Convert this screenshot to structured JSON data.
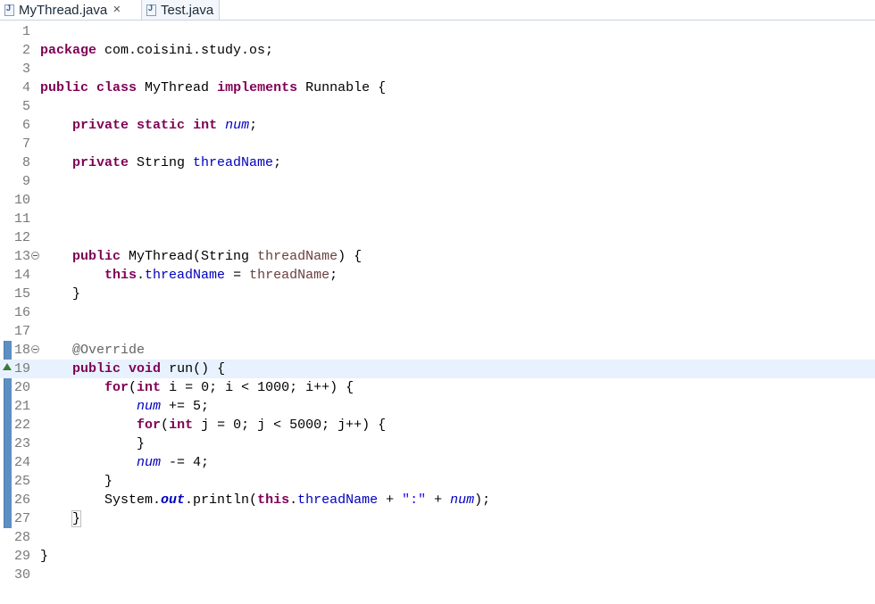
{
  "tabs": [
    {
      "label": "MyThread.java",
      "active": true,
      "close": "✕"
    },
    {
      "label": "Test.java",
      "active": false
    }
  ],
  "editor": {
    "current_line": 19,
    "lines": [
      {
        "n": "1",
        "tokens": []
      },
      {
        "n": "2",
        "tokens": [
          [
            "kw",
            "package"
          ],
          [
            "p",
            " com.coisini.study.os;"
          ]
        ]
      },
      {
        "n": "3",
        "tokens": []
      },
      {
        "n": "4",
        "tokens": [
          [
            "kw",
            "public"
          ],
          [
            "p",
            " "
          ],
          [
            "kw",
            "class"
          ],
          [
            "p",
            " MyThread "
          ],
          [
            "kw",
            "implements"
          ],
          [
            "p",
            " Runnable {"
          ]
        ]
      },
      {
        "n": "5",
        "tokens": []
      },
      {
        "n": "6",
        "tokens": [
          [
            "p",
            "    "
          ],
          [
            "kw",
            "private"
          ],
          [
            "p",
            " "
          ],
          [
            "kw",
            "static"
          ],
          [
            "p",
            " "
          ],
          [
            "kw",
            "int"
          ],
          [
            "p",
            " "
          ],
          [
            "sfld",
            "num"
          ],
          [
            "p",
            ";"
          ]
        ]
      },
      {
        "n": "7",
        "tokens": []
      },
      {
        "n": "8",
        "tokens": [
          [
            "p",
            "    "
          ],
          [
            "kw",
            "private"
          ],
          [
            "p",
            " String "
          ],
          [
            "fld",
            "threadName"
          ],
          [
            "p",
            ";"
          ]
        ]
      },
      {
        "n": "9",
        "tokens": []
      },
      {
        "n": "10",
        "tokens": []
      },
      {
        "n": "11",
        "tokens": []
      },
      {
        "n": "12",
        "tokens": []
      },
      {
        "n": "13",
        "fold": true,
        "tokens": [
          [
            "p",
            "    "
          ],
          [
            "kw",
            "public"
          ],
          [
            "p",
            " MyThread(String "
          ],
          [
            "local",
            "threadName"
          ],
          [
            "p",
            ") {"
          ]
        ]
      },
      {
        "n": "14",
        "tokens": [
          [
            "p",
            "        "
          ],
          [
            "kw",
            "this"
          ],
          [
            "p",
            "."
          ],
          [
            "fld",
            "threadName"
          ],
          [
            "p",
            " = "
          ],
          [
            "local",
            "threadName"
          ],
          [
            "p",
            ";"
          ]
        ]
      },
      {
        "n": "15",
        "tokens": [
          [
            "p",
            "    }"
          ]
        ]
      },
      {
        "n": "16",
        "tokens": []
      },
      {
        "n": "17",
        "tokens": []
      },
      {
        "n": "18",
        "fold": true,
        "tokens": [
          [
            "p",
            "    "
          ],
          [
            "ann",
            "@Override"
          ]
        ]
      },
      {
        "n": "19",
        "override": true,
        "tokens": [
          [
            "p",
            "    "
          ],
          [
            "kw",
            "public"
          ],
          [
            "p",
            " "
          ],
          [
            "kw",
            "void"
          ],
          [
            "p",
            " run() {"
          ]
        ]
      },
      {
        "n": "20",
        "tokens": [
          [
            "p",
            "        "
          ],
          [
            "kw",
            "for"
          ],
          [
            "p",
            "("
          ],
          [
            "kw",
            "int"
          ],
          [
            "p",
            " i = 0; i < 1000; i++) {"
          ]
        ]
      },
      {
        "n": "21",
        "tokens": [
          [
            "p",
            "            "
          ],
          [
            "sfld",
            "num"
          ],
          [
            "p",
            " += 5;"
          ]
        ]
      },
      {
        "n": "22",
        "tokens": [
          [
            "p",
            "            "
          ],
          [
            "kw",
            "for"
          ],
          [
            "p",
            "("
          ],
          [
            "kw",
            "int"
          ],
          [
            "p",
            " j = 0; j < 5000; j++) {"
          ]
        ]
      },
      {
        "n": "23",
        "tokens": [
          [
            "p",
            "            }"
          ]
        ]
      },
      {
        "n": "24",
        "tokens": [
          [
            "p",
            "            "
          ],
          [
            "sfld",
            "num"
          ],
          [
            "p",
            " -= 4;"
          ]
        ]
      },
      {
        "n": "25",
        "tokens": [
          [
            "p",
            "        }"
          ]
        ]
      },
      {
        "n": "26",
        "tokens": [
          [
            "p",
            "        System."
          ],
          [
            "sfldb",
            "out"
          ],
          [
            "p",
            ".println("
          ],
          [
            "kw",
            "this"
          ],
          [
            "p",
            "."
          ],
          [
            "fld",
            "threadName"
          ],
          [
            "p",
            " + "
          ],
          [
            "str",
            "\":\""
          ],
          [
            "p",
            " + "
          ],
          [
            "sfld",
            "num"
          ],
          [
            "p",
            ");"
          ]
        ]
      },
      {
        "n": "27",
        "tokens": [
          [
            "p",
            "    "
          ],
          [
            "brace",
            "}"
          ]
        ]
      },
      {
        "n": "28",
        "tokens": []
      },
      {
        "n": "29",
        "tokens": [
          [
            "p",
            "}"
          ]
        ]
      },
      {
        "n": "30",
        "tokens": []
      }
    ]
  }
}
